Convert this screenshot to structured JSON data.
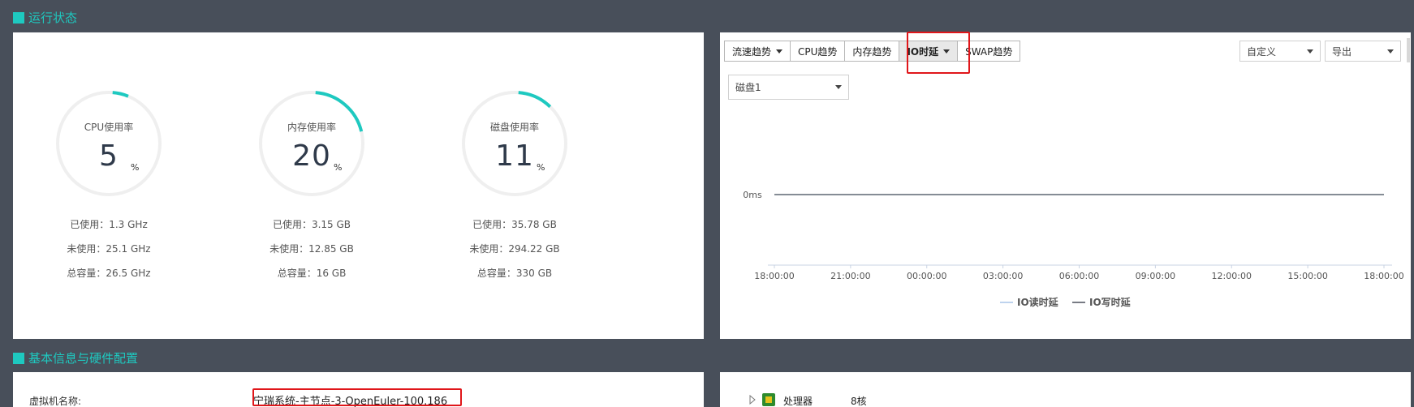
{
  "sections": {
    "status_title": "运行状态",
    "basic_title": "基本信息与硬件配置"
  },
  "gauges": [
    {
      "label": "CPU使用率",
      "value": "5",
      "unit": "%",
      "percent": 5,
      "used": "已使用：1.3 GHz",
      "unused": "未使用：25.1 GHz",
      "total": "总容量：26.5 GHz"
    },
    {
      "label": "内存使用率",
      "value": "20",
      "unit": "%",
      "percent": 20,
      "used": "已使用：3.15 GB",
      "unused": "未使用：12.85 GB",
      "total": "总容量：16 GB"
    },
    {
      "label": "磁盘使用率",
      "value": "11",
      "unit": "%",
      "percent": 11,
      "used": "已使用：35.78 GB",
      "unused": "未使用：294.22 GB",
      "total": "总容量：330 GB"
    }
  ],
  "colors": {
    "accent": "#1ec9c0",
    "ring_bg": "#efefef",
    "highlight": "#e0161a"
  },
  "toolbar": {
    "tabs": [
      "流速趋势",
      "CPU趋势",
      "内存趋势",
      "IO时延",
      "SWAP趋势"
    ],
    "active_tab": "IO时延",
    "range_select": "自定义",
    "export_select": "导出",
    "disk_select": "磁盘1"
  },
  "chart_data": {
    "type": "line",
    "x": [
      "18:00:00",
      "21:00:00",
      "00:00:00",
      "03:00:00",
      "06:00:00",
      "09:00:00",
      "12:00:00",
      "15:00:00",
      "18:00:00"
    ],
    "y_ticks": [
      "0ms"
    ],
    "series": [
      {
        "name": "IO读时延",
        "color": "#a9c4e8",
        "values": [
          0,
          0,
          0,
          0,
          0,
          0,
          0,
          0,
          0
        ]
      },
      {
        "name": "IO写时延",
        "color": "#4a4f5a",
        "values": [
          0,
          0,
          0,
          0,
          0,
          0,
          0,
          0,
          0
        ]
      }
    ],
    "legend_position": "bottom"
  },
  "basic_info": {
    "vm_name_label": "虚拟机名称:",
    "vm_name_value": "宁瑞系统-主节点-3-OpenEuler-100.186",
    "processor_label": "处理器",
    "processor_value": "8核"
  }
}
